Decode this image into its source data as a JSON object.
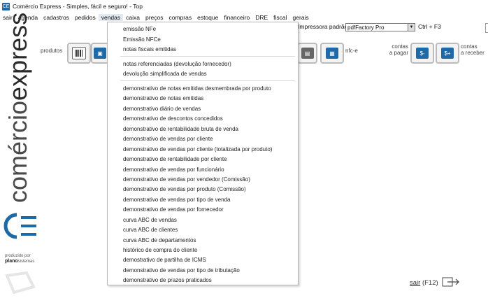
{
  "window": {
    "title": "Comércio Express - Simples, fácil e seguro! - Top",
    "app_icon": "CE"
  },
  "menubar": [
    "sair",
    "agenda",
    "cadastros",
    "pedidos",
    "vendas",
    "caixa",
    "preços",
    "compras",
    "estoque",
    "financeiro",
    "DRE",
    "fiscal",
    "gerais"
  ],
  "toolbar": {
    "produtos_label": "produtos",
    "nfce_label": "nfc-e",
    "contas_pagar_label": "contas\na pagar",
    "contas_receber_label": "contas\na receber"
  },
  "printer": {
    "label": "Impressora padrão",
    "value": "pdfFactory Pro",
    "shortcut": "Ctrl + F3"
  },
  "brand": {
    "vertical_thin": "comércio",
    "vertical_bold": "express",
    "produced_by": "produzido por",
    "company_a": "plano",
    "company_b": "sistemas"
  },
  "vendas_menu": {
    "group1": [
      "emissão NFe",
      "Emissão NFCe",
      "notas fiscais emitidas"
    ],
    "group2": [
      "notas referenciadas (devolução fornecedor)",
      "devolução simplificada de vendas"
    ],
    "group3": [
      "demonstrativo de notas emitidas desmembrada por produto",
      "demonstrativo de notas emitidas",
      "demonstrativo diário de vendas",
      "demonstrativo de descontos concedidos",
      "demonstrativo de rentabilidade bruta de venda",
      "demonstrativo de vendas por cliente",
      "demonstrativo de vendas por cliente (totalizada por produto)",
      "demonstrativo de rentabilidade por cliente",
      "demonstrativo de vendas por funcionário",
      "demonstrativo de vendas por vendedor (Comissão)",
      "demonstrativo de vendas por produto (Comissão)",
      "demonstrativo de vendas  por tipo de venda",
      "demonstrativo de vendas por fornecedor",
      "curva ABC de vendas",
      "curva ABC de clientes",
      "curva ABC de departamentos",
      "histórico de compra do cliente",
      "demostrativo de partilha de ICMS",
      "demonstrativo de vendas por tipo de tributação",
      "demonstrativo de prazos praticados"
    ]
  },
  "footer": {
    "sair_label": "sair",
    "sair_shortcut": "(F12)"
  }
}
